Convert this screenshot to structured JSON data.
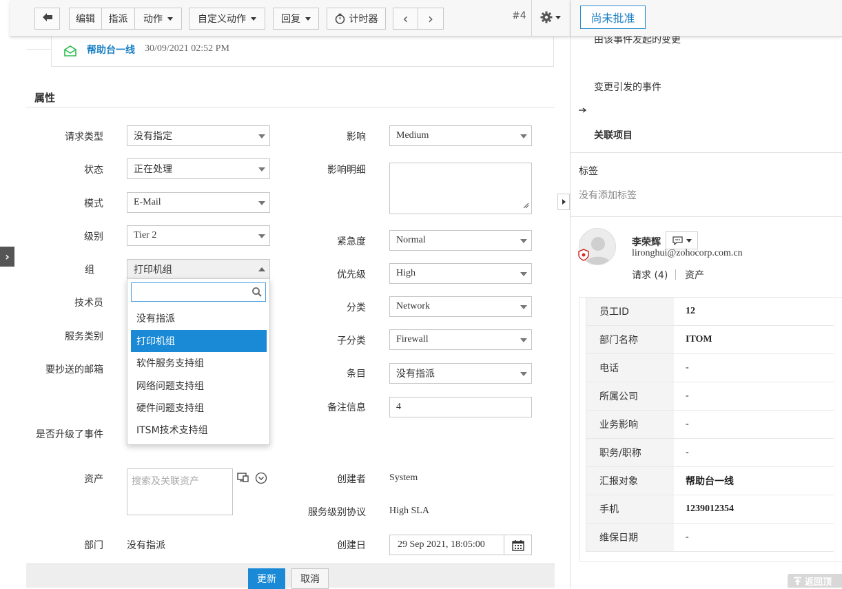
{
  "toolbar": {
    "edit": "编辑",
    "assign": "指派",
    "actions": "动作",
    "custom_actions": "自定义动作",
    "reply": "回复",
    "timer": "计时器",
    "request_no": "#4",
    "status": "尚未批准"
  },
  "note": {
    "sender": "帮助台一线",
    "time": "30/09/2021 02:52 PM"
  },
  "section_title": "属性",
  "fields_left": {
    "request_type": {
      "label": "请求类型",
      "value": "没有指定"
    },
    "status": {
      "label": "状态",
      "value": "正在处理"
    },
    "mode": {
      "label": "模式",
      "value": "E-Mail"
    },
    "level": {
      "label": "级别",
      "value": "Tier 2"
    },
    "group": {
      "label": "组",
      "value": "打印机组"
    },
    "technician": {
      "label": "技术员"
    },
    "service_category": {
      "label": "服务类别"
    },
    "cc_email": {
      "label": "要抄送的邮箱"
    },
    "escalated": {
      "label": "是否升级了事件"
    },
    "asset": {
      "label": "资产",
      "placeholder": "搜索及关联资产"
    },
    "department": {
      "label": "部门",
      "value": "没有指派"
    }
  },
  "fields_right": {
    "impact": {
      "label": "影响",
      "value": "Medium"
    },
    "impact_details": {
      "label": "影响明细",
      "value": ""
    },
    "urgency": {
      "label": "紧急度",
      "value": "Normal"
    },
    "priority": {
      "label": "优先级",
      "value": "High"
    },
    "category": {
      "label": "分类",
      "value": "Network"
    },
    "subcategory": {
      "label": "子分类",
      "value": "Firewall"
    },
    "item": {
      "label": "条目",
      "value": "没有指派"
    },
    "notes": {
      "label": "备注信息",
      "value": "4"
    },
    "created_by": {
      "label": "创建者",
      "value": "System"
    },
    "sla": {
      "label": "服务级别协议",
      "value": "High SLA"
    },
    "created_date": {
      "label": "创建日",
      "value": "29 Sep 2021, 18:05:00"
    }
  },
  "group_dropdown": {
    "search_value": "",
    "options": [
      "没有指派",
      "打印机组",
      "软件服务支持组",
      "网络问题支持组",
      "硬件问题支持组",
      "ITSM技术支持组"
    ],
    "selected": "打印机组"
  },
  "buttons": {
    "update": "更新",
    "cancel": "取消"
  },
  "right_panel": {
    "partial_text": "由该事件发起的变更",
    "changes_caused": "变更引发的事件",
    "related_items": "关联项目",
    "tags_title": "标签",
    "no_tags": "没有添加标签",
    "requester_name": "李荣辉",
    "requester_email": "lironghui@zohocorp.com.cn",
    "requests_link": "请求 (4)",
    "assets_link": "资产",
    "back_to_top": "返回顶"
  },
  "employee_info": [
    {
      "key": "员工ID",
      "value": "12"
    },
    {
      "key": "部门名称",
      "value": "ITOM"
    },
    {
      "key": "电话",
      "value": "-"
    },
    {
      "key": "所属公司",
      "value": "-"
    },
    {
      "key": "业务影响",
      "value": "-"
    },
    {
      "key": "职务/职称",
      "value": "-"
    },
    {
      "key": "汇报对象",
      "value": "帮助台一线"
    },
    {
      "key": "手机",
      "value": "1239012354"
    },
    {
      "key": "维保日期",
      "value": "-"
    }
  ],
  "colors": {
    "accent": "#1a8ad6",
    "link": "#1a7fc4",
    "mail_icon": "#2dbb4e"
  }
}
